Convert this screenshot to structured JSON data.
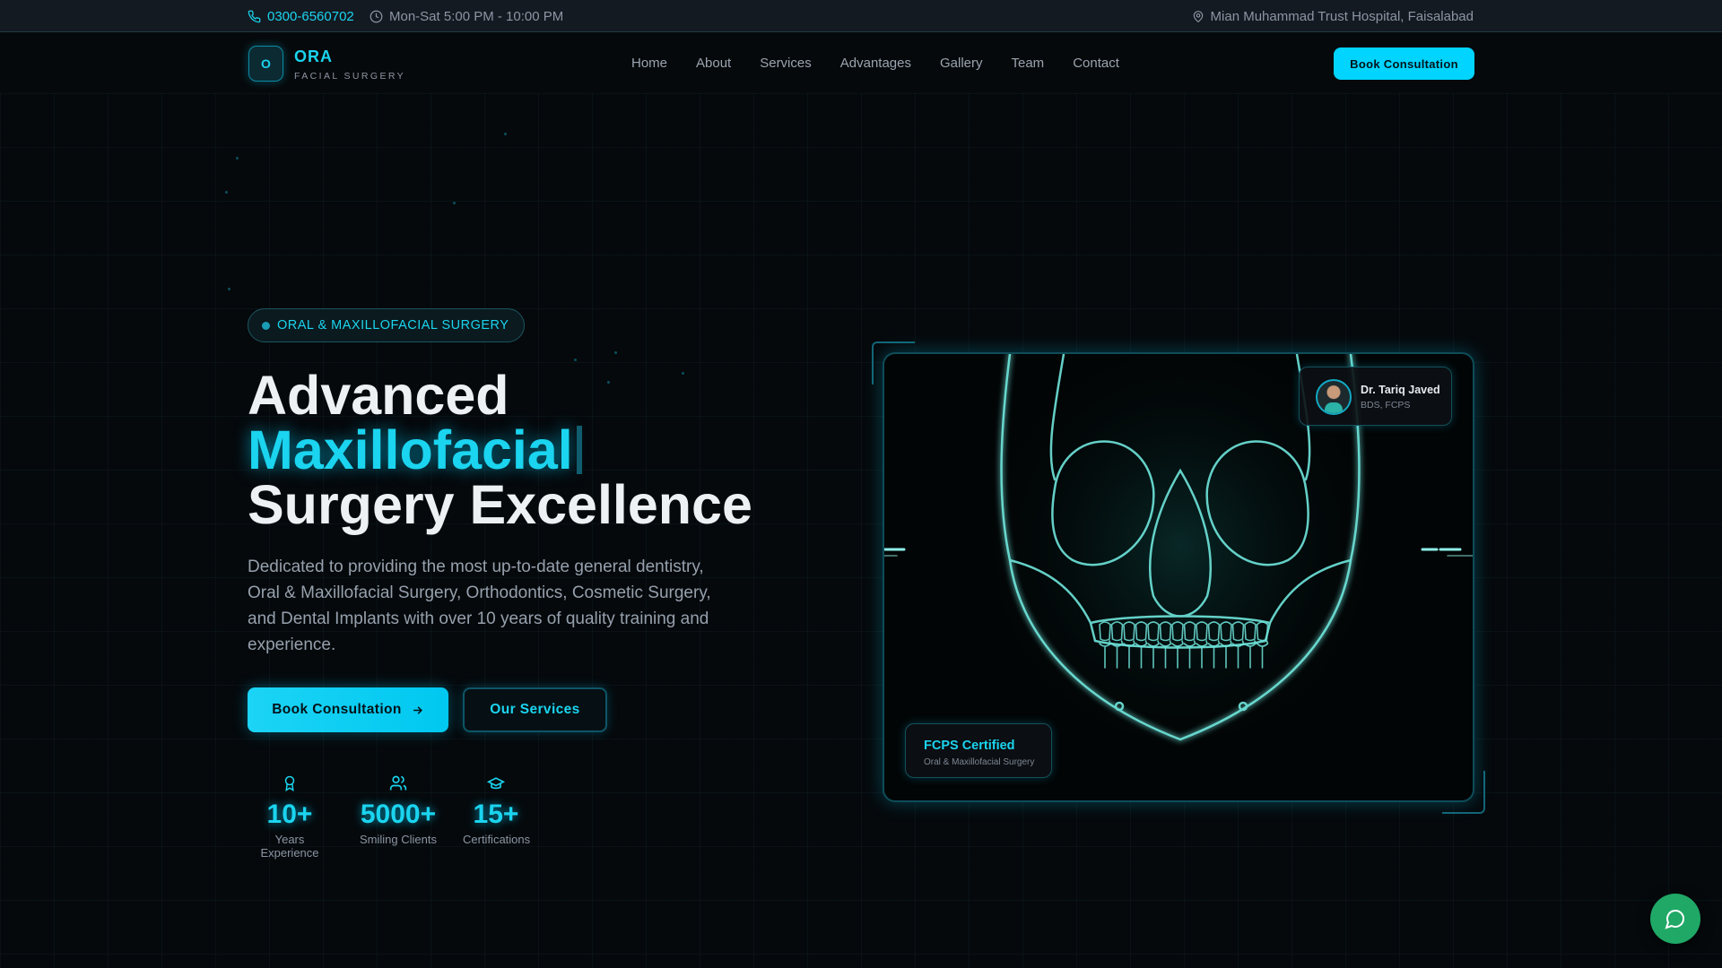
{
  "topbar": {
    "phone": "0300-6560702",
    "hours": "Mon-Sat 5:00 PM - 10:00 PM",
    "location": "Mian Muhammad Trust Hospital, Faisalabad"
  },
  "brand": {
    "logo_letter": "O",
    "name": "ORA",
    "subtitle": "FACIAL SURGERY"
  },
  "nav": {
    "links": [
      "Home",
      "About",
      "Services",
      "Advantages",
      "Gallery",
      "Team",
      "Contact"
    ],
    "cta": "Book Consultation"
  },
  "hero": {
    "badge": "ORAL & MAXILLOFACIAL SURGERY",
    "title_line1": "Advanced",
    "title_accent": "Maxillofacial",
    "title_line3": "Surgery Excellence",
    "description": "Dedicated to providing the most up-to-date general dentistry, Oral & Maxillofacial Surgery, Orthodontics, Cosmetic Surgery, and Dental Implants with over 10 years of quality training and experience.",
    "primary_button": "Book Consultation",
    "secondary_button": "Our Services",
    "stats": [
      {
        "icon": "award-icon",
        "value": "10+",
        "label": "Years Experience"
      },
      {
        "icon": "users-icon",
        "value": "5000+",
        "label": "Smiling Clients"
      },
      {
        "icon": "graduation-cap-icon",
        "value": "15+",
        "label": "Certifications"
      }
    ]
  },
  "image_card": {
    "doctor": {
      "name": "Dr. Tariq Javed",
      "credentials": "BDS, FCPS"
    },
    "certification": {
      "title": "FCPS Certified",
      "subtitle": "Oral & Maxillofacial Surgery"
    }
  },
  "colors": {
    "accent": "#00d4ff",
    "background": "#05090c",
    "chat": "#1fa866"
  }
}
